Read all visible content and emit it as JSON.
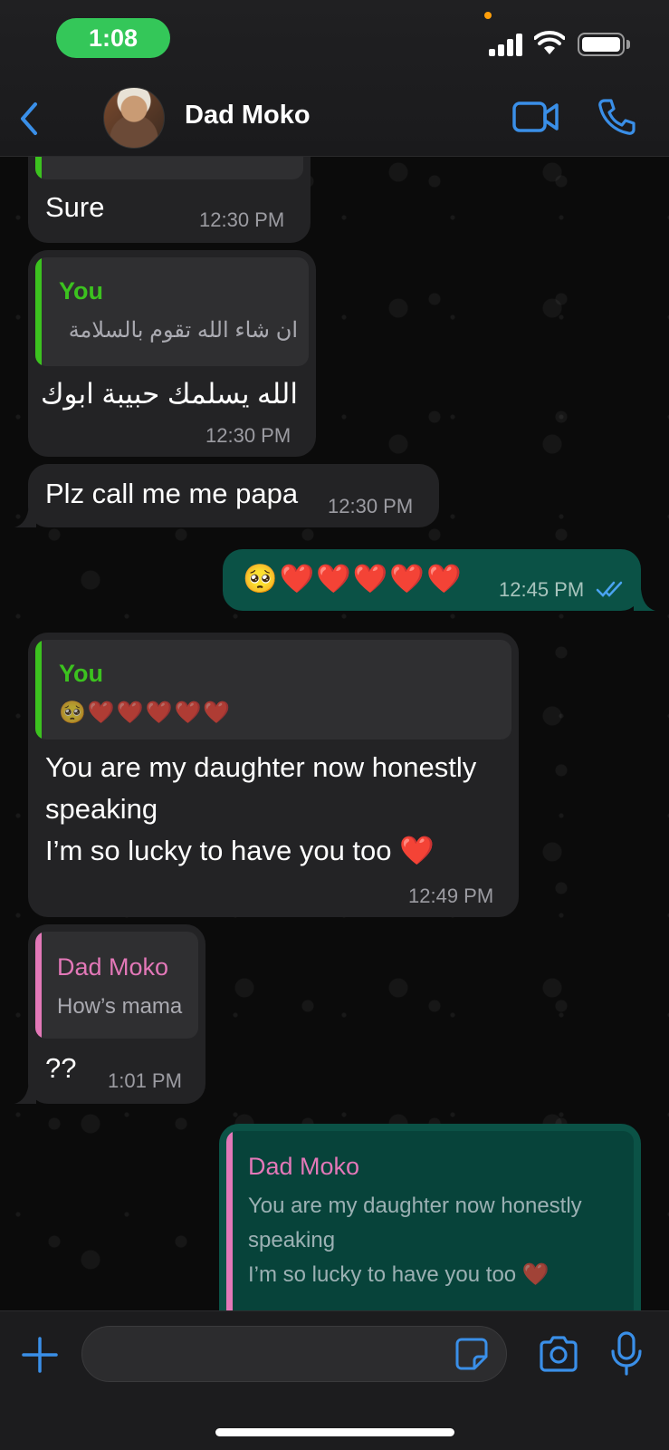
{
  "status_bar": {
    "time": "1:08"
  },
  "header": {
    "contact_name": "Dad Moko"
  },
  "messages": {
    "m1": {
      "text": "Sure",
      "time": "12:30 PM"
    },
    "m2": {
      "quote_author": "You",
      "quote_text": "ان شاء الله تقوم بالسلامة",
      "text": "الله يسلمك حبيبة ابوك",
      "time": "12:30 PM"
    },
    "m3": {
      "text": "Plz call me me papa",
      "time": "12:30 PM"
    },
    "m4": {
      "text": "🥺❤️❤️❤️❤️❤️",
      "time": "12:45 PM",
      "status": "read"
    },
    "m5": {
      "quote_author": "You",
      "quote_text": "🥺❤️❤️❤️❤️❤️",
      "line1": "You are my daughter now honestly",
      "line2": "speaking",
      "line3": "I’m so lucky to have you too ❤️",
      "time": "12:49 PM"
    },
    "m6": {
      "quote_author": "Dad Moko",
      "quote_text": "How’s mama",
      "text": "??",
      "time": "1:01 PM"
    },
    "m7": {
      "quote_author": "Dad Moko",
      "quote_line1": "You are my daughter now honestly",
      "quote_line2": "speaking",
      "quote_line3": "I’m so lucky to have you too ❤️"
    }
  },
  "input": {
    "value": "",
    "placeholder": ""
  },
  "colors": {
    "accent": "#3a8fe8",
    "you_quote": "#3cc21f",
    "dad_quote": "#e378b8",
    "incoming_bubble": "#232325",
    "outgoing_bubble": "#0b5246"
  }
}
